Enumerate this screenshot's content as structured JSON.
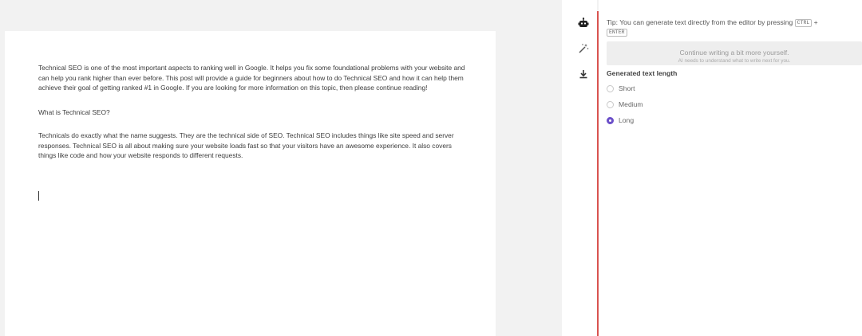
{
  "document": {
    "intro": "Technical SEO is one of the most important aspects to ranking well in Google. It helps you fix some foundational problems with your website and can help you rank higher than ever before. This post will provide a guide for beginners about how to do Technical SEO and how it can help them achieve their goal of getting ranked #1 in Google. If you are looking for more information on this topic, then please continue reading!",
    "heading": "What is Technical SEO?",
    "body": "Technicals do exactly what the name suggests. They are the technical side of SEO. Technical SEO includes things like site speed and server responses. Technical SEO is all about making sure your website loads fast so that your visitors have an awesome experience. It also covers things like code and how your website responds to different requests."
  },
  "toolbar": {
    "icons": [
      "robot-icon",
      "magic-wand-icon",
      "download-icon"
    ]
  },
  "panel": {
    "tip_text": "Tip: You can generate text directly from the editor by pressing",
    "tip_key1": "CTRL",
    "tip_plus": "+",
    "tip_key2": "ENTER",
    "continue_title": "Continue writing a bit more yourself.",
    "continue_sub": "AI needs to understand what to write next for you.",
    "length_label": "Generated text length",
    "options": [
      {
        "label": "Short",
        "selected": false
      },
      {
        "label": "Medium",
        "selected": false
      },
      {
        "label": "Long",
        "selected": true
      }
    ]
  },
  "colors": {
    "accent_purple": "#6b4fc9",
    "divider_red": "#d9534f"
  }
}
